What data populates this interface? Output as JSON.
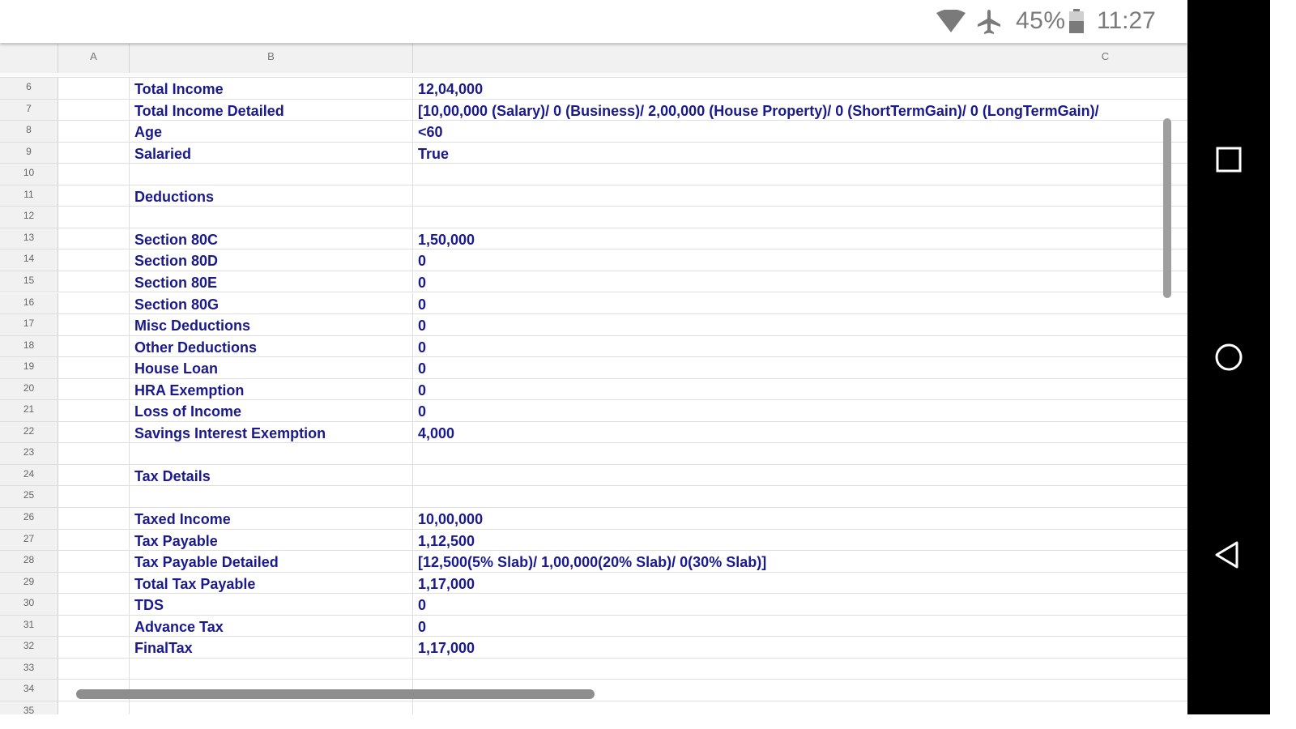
{
  "status_bar": {
    "battery_percent": "45%",
    "time": "11:27"
  },
  "columns": [
    "A",
    "B",
    "C"
  ],
  "rows": [
    {
      "num": "6",
      "label": "Total Income",
      "value": "12,04,000"
    },
    {
      "num": "7",
      "label": "Total Income Detailed",
      "value": "[10,00,000 (Salary)/ 0 (Business)/ 2,00,000 (House Property)/ 0 (ShortTermGain)/ 0 (LongTermGain)/"
    },
    {
      "num": "8",
      "label": "Age",
      "value": "<60"
    },
    {
      "num": "9",
      "label": "Salaried",
      "value": "True"
    },
    {
      "num": "10",
      "label": "",
      "value": ""
    },
    {
      "num": "11",
      "label": "Deductions",
      "value": ""
    },
    {
      "num": "12",
      "label": "",
      "value": ""
    },
    {
      "num": "13",
      "label": "Section 80C",
      "value": "1,50,000"
    },
    {
      "num": "14",
      "label": "Section 80D",
      "value": "0"
    },
    {
      "num": "15",
      "label": "Section 80E",
      "value": "0"
    },
    {
      "num": "16",
      "label": "Section 80G",
      "value": "0"
    },
    {
      "num": "17",
      "label": "Misc Deductions",
      "value": "0"
    },
    {
      "num": "18",
      "label": "Other Deductions",
      "value": "0"
    },
    {
      "num": "19",
      "label": "House Loan",
      "value": "0"
    },
    {
      "num": "20",
      "label": "HRA Exemption",
      "value": "0"
    },
    {
      "num": "21",
      "label": "Loss of Income",
      "value": "0"
    },
    {
      "num": "22",
      "label": "Savings Interest Exemption",
      "value": "4,000"
    },
    {
      "num": "23",
      "label": "",
      "value": ""
    },
    {
      "num": "24",
      "label": "Tax Details",
      "value": ""
    },
    {
      "num": "25",
      "label": "",
      "value": ""
    },
    {
      "num": "26",
      "label": "Taxed Income",
      "value": "10,00,000"
    },
    {
      "num": "27",
      "label": "Tax Payable",
      "value": "1,12,500"
    },
    {
      "num": "28",
      "label": "Tax Payable Detailed",
      "value": "[12,500(5% Slab)/ 1,00,000(20% Slab)/ 0(30% Slab)]"
    },
    {
      "num": "29",
      "label": "Total Tax Payable",
      "value": "1,17,000"
    },
    {
      "num": "30",
      "label": "TDS",
      "value": "0"
    },
    {
      "num": "31",
      "label": "Advance Tax",
      "value": "0"
    },
    {
      "num": "32",
      "label": "FinalTax",
      "value": "1,17,000"
    },
    {
      "num": "33",
      "label": "",
      "value": ""
    },
    {
      "num": "34",
      "label": "",
      "value": ""
    },
    {
      "num": "35",
      "label": "",
      "value": ""
    }
  ],
  "icons": {
    "wifi": "wifi-icon",
    "airplane": "airplane-mode-icon",
    "battery": "battery-icon",
    "recents": "recents-square-icon",
    "home": "home-circle-icon",
    "back": "back-triangle-icon"
  },
  "colors": {
    "cell_text": "#1a1a8c",
    "header_bg": "#f1f1f1",
    "nav_bg": "#000000"
  }
}
